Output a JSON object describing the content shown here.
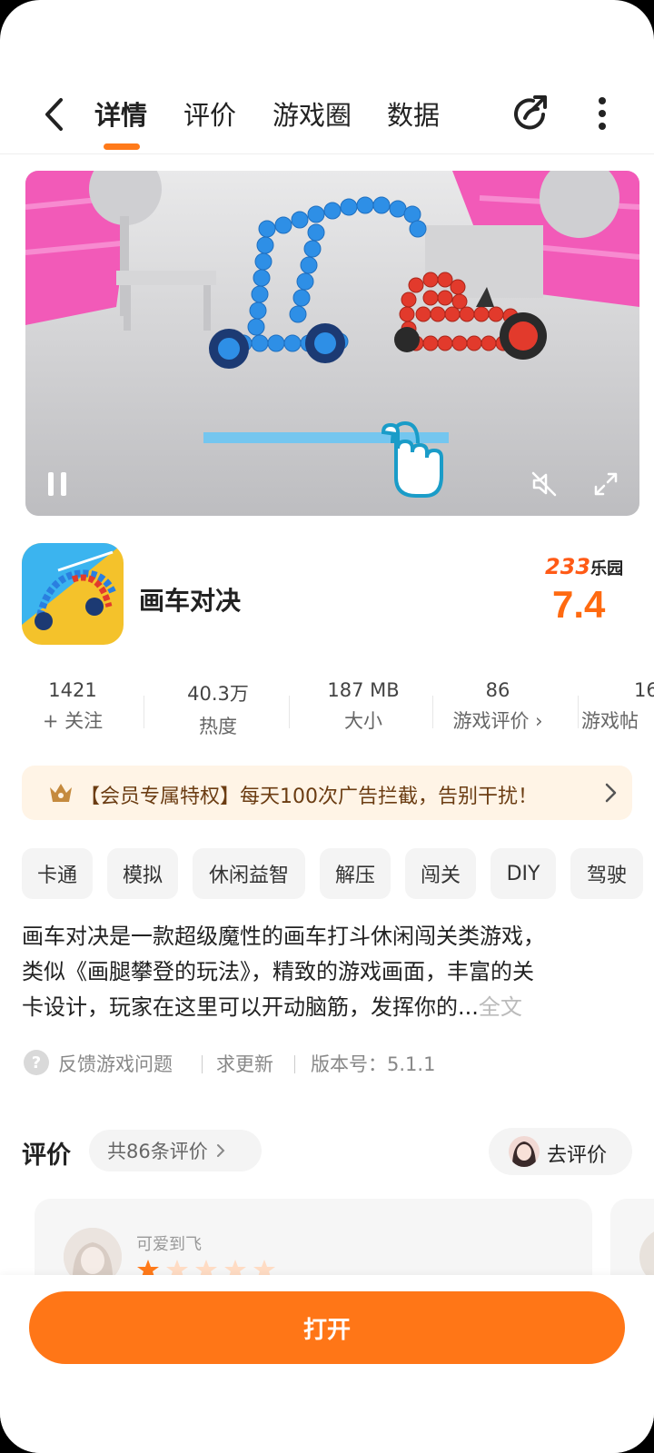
{
  "nav": {
    "tabs": [
      {
        "label": "详情",
        "active": true
      },
      {
        "label": "评价",
        "active": false
      },
      {
        "label": "游戏圈",
        "active": false
      },
      {
        "label": "数据",
        "active": false
      }
    ],
    "accent_color": "#ff7a1a",
    "icons": [
      "back-arrow-icon",
      "share-icon",
      "more-vert-icon"
    ]
  },
  "video": {
    "playing": true,
    "muted": true,
    "icons": [
      "pause-icon",
      "mute-icon",
      "fullscreen-icon",
      "tap-hand-icon"
    ]
  },
  "app": {
    "name": "画车对决",
    "brand_number": "233",
    "brand_name": "乐园",
    "score": "7.4"
  },
  "stats": [
    {
      "value": "1421",
      "label": "+ 关注"
    },
    {
      "value": "40.3万",
      "label": "热度"
    },
    {
      "value": "187 MB",
      "label": "大小"
    },
    {
      "value": "86",
      "label": "游戏评价 ›"
    },
    {
      "value": "16",
      "label": "游戏帖"
    }
  ],
  "vip": {
    "text": "【会员专属特权】每天100次广告拦截，告别干扰！"
  },
  "tags": [
    "卡通",
    "模拟",
    "休闲益智",
    "解压",
    "闯关",
    "DIY",
    "驾驶"
  ],
  "description": {
    "line1": "画车对决是一款超级魔性的画车打斗休闲闯关类游戏，",
    "line2": "类似《画腿攀登的玩法》，精致的游戏画面，丰富的关",
    "line3": "卡设计，玩家在这里可以开动脑筋，发挥你的...",
    "more": "全文"
  },
  "feedback": {
    "report": "反馈游戏问题",
    "update": "求更新",
    "version": "版本号：5.1.1"
  },
  "reviews": {
    "title": "评价",
    "count": "共86条评价",
    "write": "去评价",
    "items": [
      {
        "user": "可爱到飞",
        "rating": 1
      }
    ]
  },
  "bottom": {
    "open_label": "打开",
    "color": "#ff7617"
  }
}
